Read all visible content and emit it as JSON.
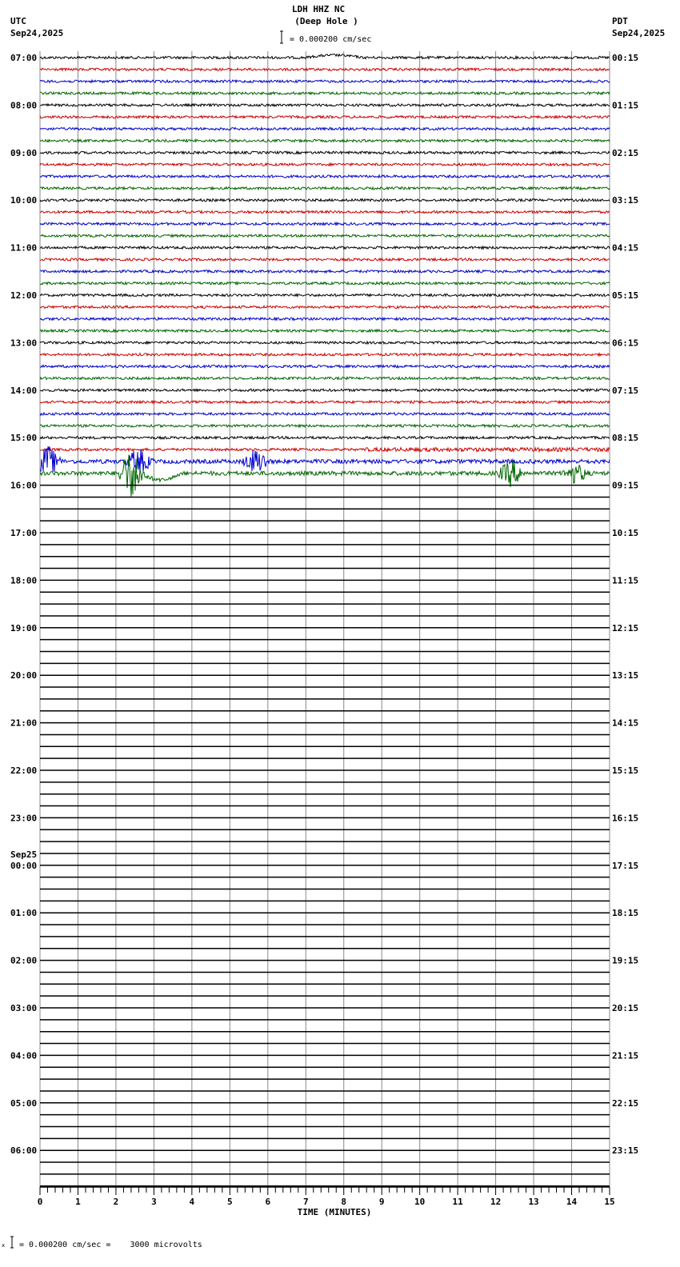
{
  "header": {
    "title": "LDH HHZ NC",
    "subtitle": "(Deep Hole )",
    "left_tz": "UTC",
    "left_date": "Sep24,2025",
    "right_tz": "PDT",
    "right_date": "Sep24,2025",
    "scale_text": "= 0.000200 cm/sec"
  },
  "footer": {
    "scale_text": "= 0.000200 cm/sec =    3000 microvolts",
    "scale_prefix": "x"
  },
  "chart_data": {
    "type": "line",
    "title": "LDH HHZ NC (Deep Hole )",
    "xlabel": "TIME (MINUTES)",
    "xlim": [
      0,
      15
    ],
    "x_ticks": [
      "0",
      "1",
      "2",
      "3",
      "4",
      "5",
      "6",
      "7",
      "8",
      "9",
      "10",
      "11",
      "12",
      "13",
      "14",
      "15"
    ],
    "minutes_per_line": 15,
    "trace_colors": [
      "#000000",
      "#cc0000",
      "#0000cc",
      "#006600"
    ],
    "utc_labels": [
      "07:00",
      "08:00",
      "09:00",
      "10:00",
      "11:00",
      "12:00",
      "13:00",
      "14:00",
      "15:00",
      "16:00",
      "17:00",
      "18:00",
      "19:00",
      "20:00",
      "21:00",
      "22:00",
      "23:00",
      "00:00",
      "01:00",
      "02:00",
      "03:00",
      "04:00",
      "05:00",
      "06:00"
    ],
    "date_change_label": "Sep25",
    "pdt_labels": [
      "00:15",
      "01:15",
      "02:15",
      "03:15",
      "04:15",
      "05:15",
      "06:15",
      "07:15",
      "08:15",
      "09:15",
      "10:15",
      "11:15",
      "12:15",
      "13:15",
      "14:15",
      "15:15",
      "16:15",
      "17:15",
      "18:15",
      "19:15",
      "20:15",
      "21:15",
      "22:15",
      "23:15"
    ],
    "recorded_lines": 36,
    "total_lines": 96,
    "events": [
      {
        "line": 34,
        "minute": 0.2,
        "amplitude": 2.5
      },
      {
        "line": 34,
        "minute": 2.6,
        "amplitude": 2
      },
      {
        "line": 34,
        "minute": 5.7,
        "amplitude": 2
      },
      {
        "line": 35,
        "minute": 2.4,
        "amplitude": 4
      },
      {
        "line": 35,
        "minute": 12.4,
        "amplitude": 2
      },
      {
        "line": 35,
        "minute": 14.1,
        "amplitude": 1.5
      }
    ]
  }
}
